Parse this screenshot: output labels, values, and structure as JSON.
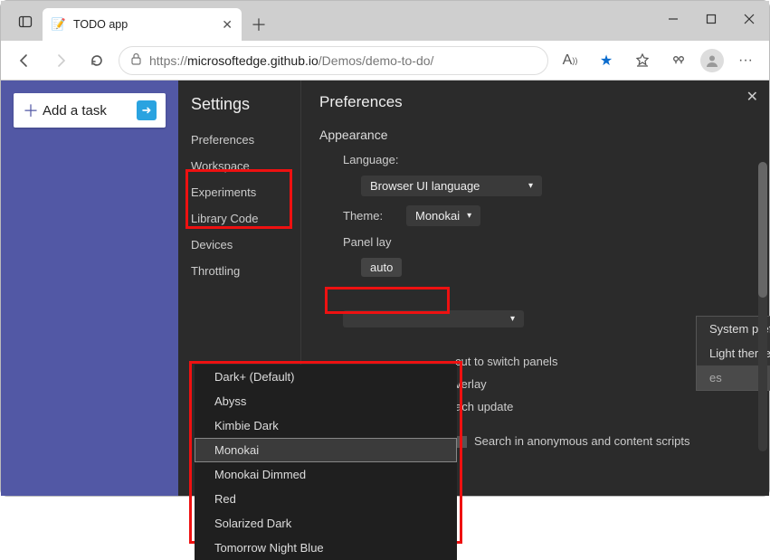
{
  "browser": {
    "tab_title": "TODO app",
    "url_prefix": "https://",
    "url_host": "microsoftedge.github.io",
    "url_path": "/Demos/demo-to-do/"
  },
  "page": {
    "add_task": "Add a task"
  },
  "devtools": {
    "title": "Settings",
    "sidebar": [
      "Preferences",
      "Workspace",
      "Experiments",
      "Library Code",
      "Devices",
      "Throttling"
    ],
    "heading": "Preferences",
    "section": "Appearance",
    "language_label": "Language:",
    "language_value": "Browser UI language",
    "theme_label": "Theme:",
    "theme_value": "Monokai",
    "panel_label": "Panel lay",
    "panel_value": "auto",
    "theme_menu": {
      "sys": "System preference",
      "light": "Light themes",
      "partial": "es"
    },
    "dark_themes": [
      "Dark+ (Default)",
      "Abyss",
      "Kimbie Dark",
      "Monokai",
      "Monokai Dimmed",
      "Red",
      "Solarized Dark",
      "Tomorrow Night Blue"
    ],
    "opts": {
      "shortcut": "cut to switch panels",
      "overlay": "verlay",
      "update": "ach update",
      "search": "Search in anonymous and content scripts"
    }
  }
}
